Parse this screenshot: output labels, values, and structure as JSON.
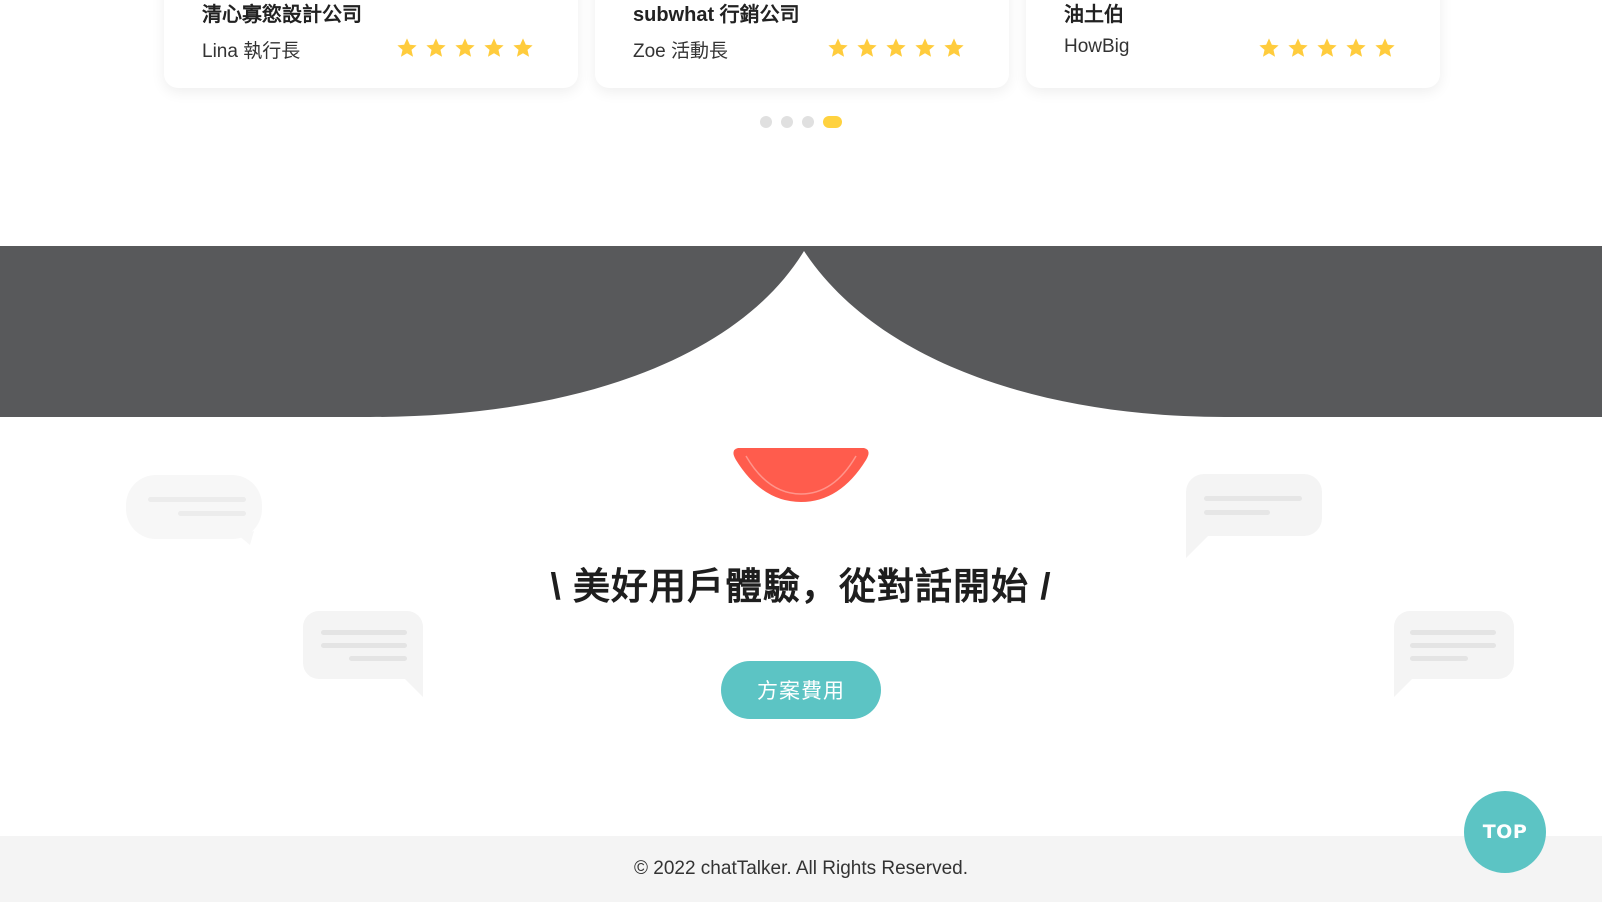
{
  "testimonials": [
    {
      "company": "清心寡慾設計公司",
      "person": "Lina 執行長",
      "rating": 5
    },
    {
      "company": "subwhat 行銷公司",
      "person": "Zoe 活動長",
      "rating": 5
    },
    {
      "company": "油土伯",
      "person": "HowBig",
      "rating": 5
    }
  ],
  "carousel": {
    "total_pages": 4,
    "active_page": 4
  },
  "cta": {
    "headline": "\\ 美好用戶體驗，從對話開始 /",
    "button_label": "方案費用"
  },
  "footer": {
    "copyright": "© 2022 chatTalker. All Rights Reserved."
  },
  "top_button": {
    "label": "TOP"
  },
  "colors": {
    "accent_teal": "#5cc4c4",
    "star_yellow": "#ffcc3d",
    "band_dark": "#58595b",
    "mouth_red": "#ff5c4d",
    "dot_active": "#ffd23f"
  }
}
